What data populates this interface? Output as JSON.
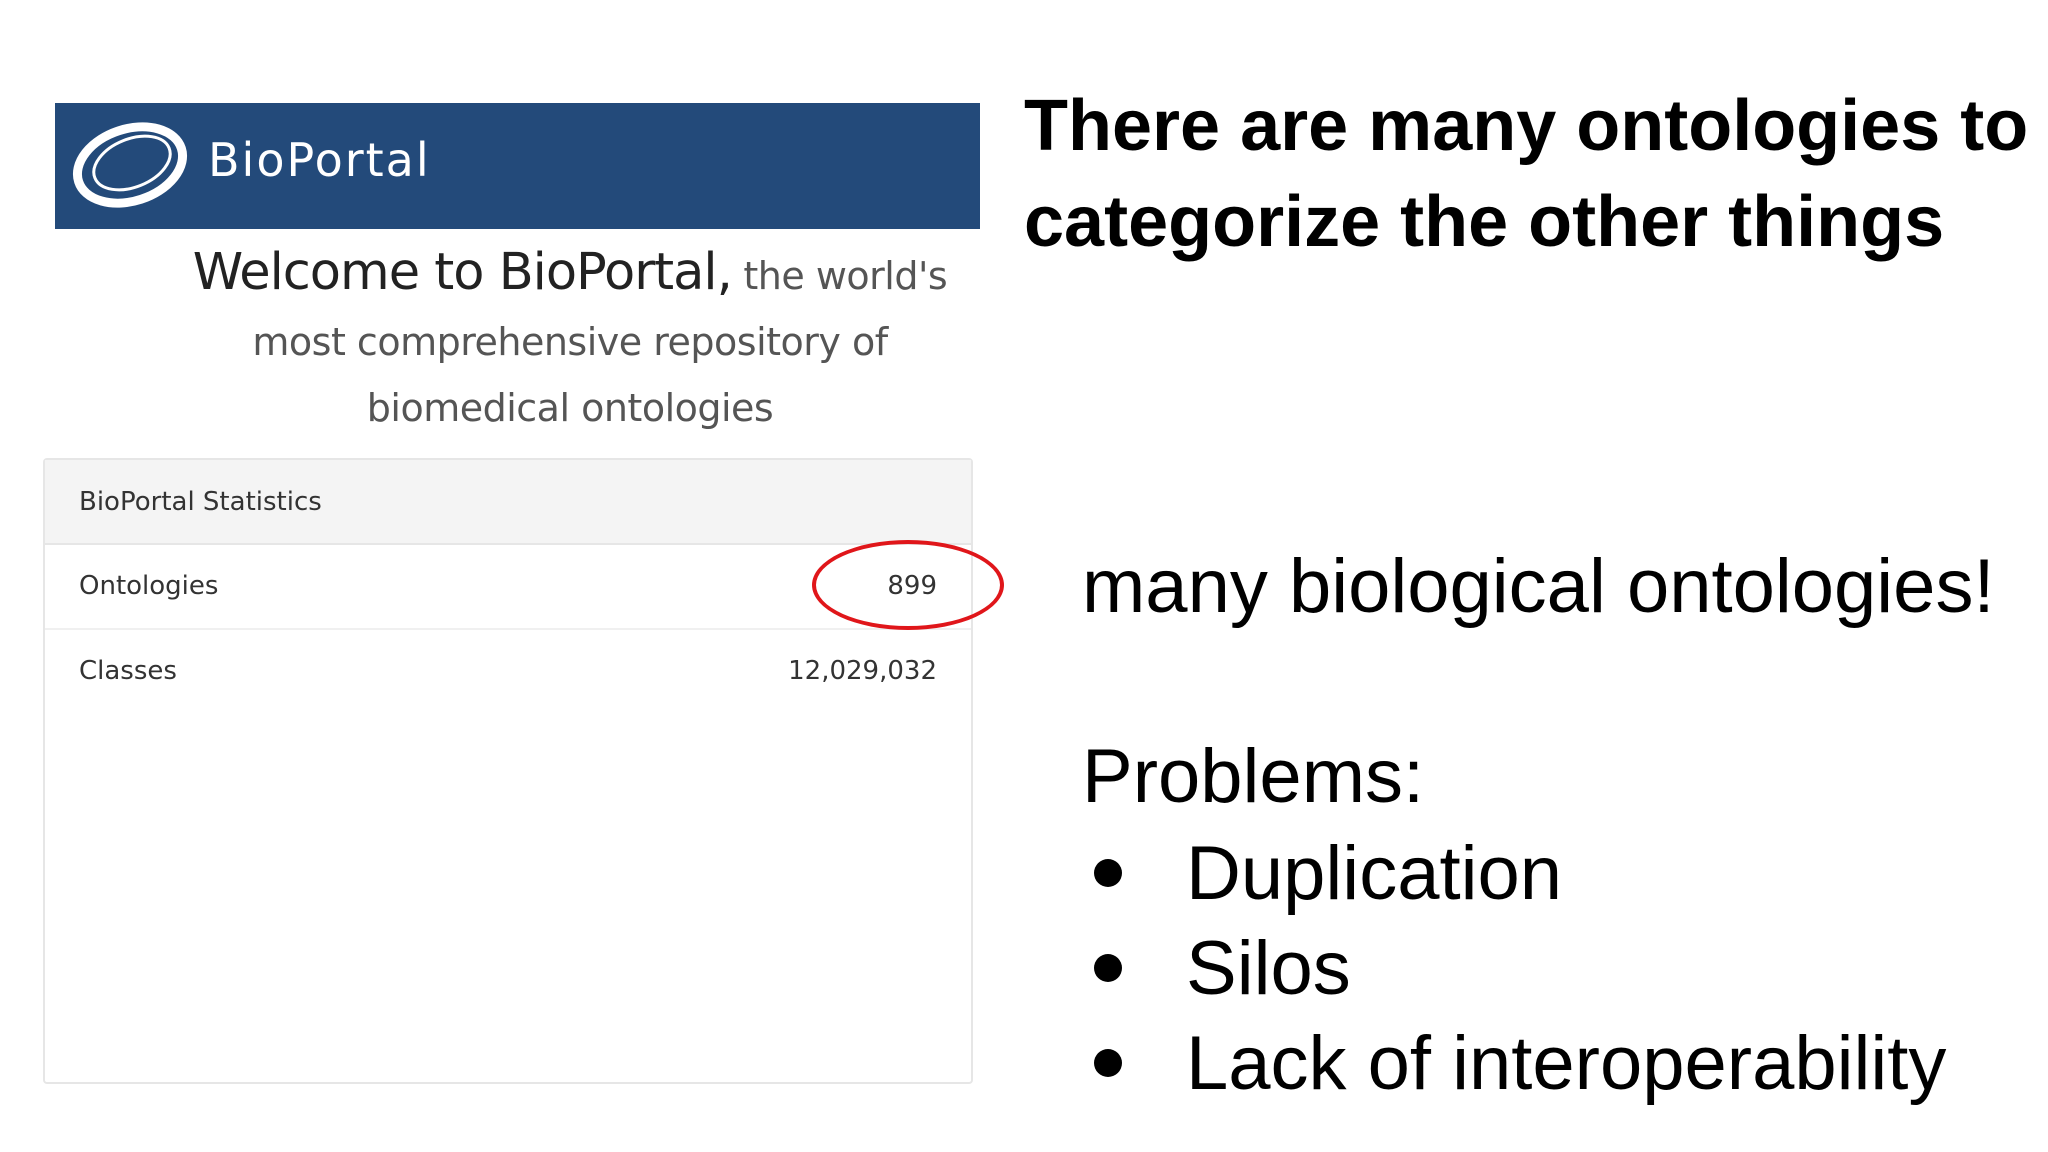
{
  "bioportal": {
    "logo_text": "BioPortal",
    "welcome_strong": "Welcome to BioPortal,",
    "welcome_rest": " the world's most comprehensive repository of biomedical ontologies",
    "stats": {
      "heading": "BioPortal Statistics",
      "rows": [
        {
          "label": "Ontologies",
          "value": "899"
        },
        {
          "label": "Classes",
          "value": "12,029,032"
        }
      ]
    },
    "header_color": "#234a7a",
    "highlight_color": "#e0161a"
  },
  "slide": {
    "title": "There are many ontologies to categorize the other things",
    "subtitle": "many biological ontologies!",
    "problems_label": "Problems:",
    "problems": [
      "Duplication",
      "Silos",
      "Lack of interoperability"
    ]
  }
}
